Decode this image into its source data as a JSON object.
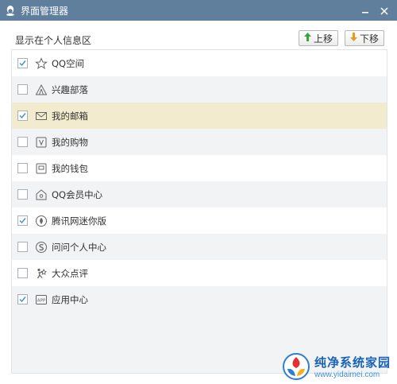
{
  "window": {
    "title": "界面管理器",
    "icon": "qq-penguin-icon",
    "controls": {
      "minimize": "minimize-icon",
      "close": "close-icon"
    }
  },
  "header": {
    "label": "显示在个人信息区",
    "up_button": "上移",
    "down_button": "下移"
  },
  "items": [
    {
      "label": "QQ空间",
      "checked": true,
      "icon": "star-icon"
    },
    {
      "label": "兴趣部落",
      "checked": false,
      "icon": "tent-icon"
    },
    {
      "label": "我的邮箱",
      "checked": true,
      "icon": "mail-icon",
      "selected": true
    },
    {
      "label": "我的购物",
      "checked": false,
      "icon": "shopping-icon"
    },
    {
      "label": "我的钱包",
      "checked": false,
      "icon": "wallet-icon"
    },
    {
      "label": "QQ会员中心",
      "checked": false,
      "icon": "vip-house-icon"
    },
    {
      "label": "腾讯网迷你版",
      "checked": true,
      "icon": "tencent-news-icon"
    },
    {
      "label": "问问个人中心",
      "checked": false,
      "icon": "wenwen-icon"
    },
    {
      "label": "大众点评",
      "checked": false,
      "icon": "dianping-icon"
    },
    {
      "label": "应用中心",
      "checked": true,
      "icon": "app-center-icon"
    }
  ],
  "watermark": {
    "logo": "watermark-logo-icon",
    "name": "纯净系统家园",
    "url": "www.yidaimei.com"
  },
  "colors": {
    "titlebar": "#5f7f9d",
    "selected_row": "#f3ebcd",
    "checkmark": "#3a8fd4",
    "up_arrow": "#3aa33a",
    "down_arrow": "#e79a1b"
  }
}
